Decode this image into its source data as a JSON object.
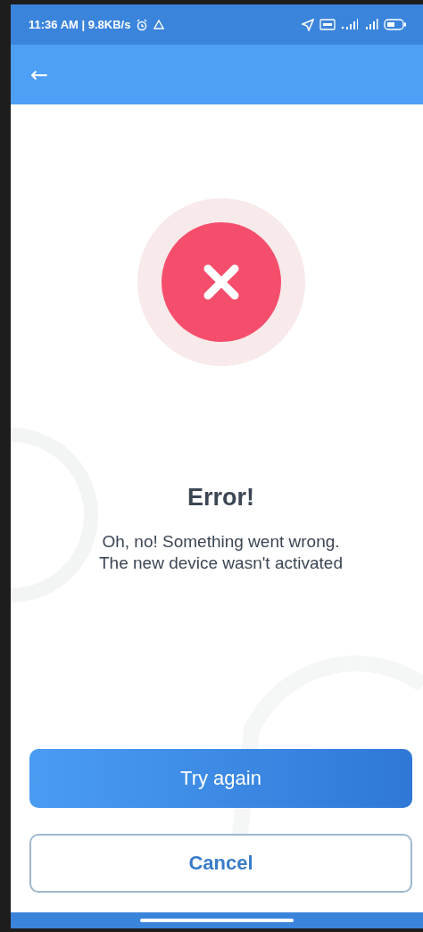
{
  "status_bar": {
    "time": "11:36 AM | 9.8KB/s"
  },
  "app_bar": {
    "back": "←"
  },
  "result": {
    "title": "Error!",
    "message": "Oh, no! Something went wrong.\nThe new device wasn't activated"
  },
  "buttons": [
    {
      "label": "Try again",
      "kind": "primary"
    },
    {
      "label": "Cancel",
      "kind": "secondary"
    }
  ]
}
